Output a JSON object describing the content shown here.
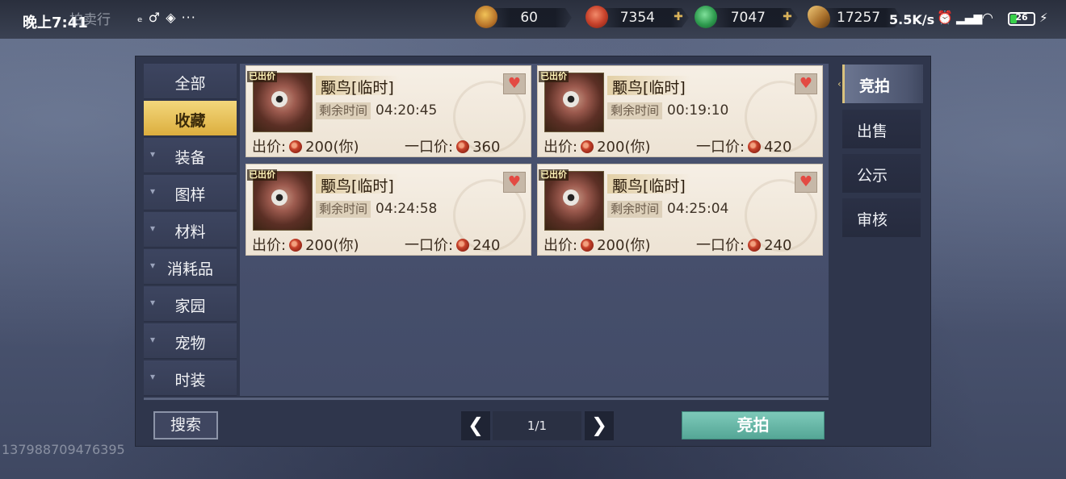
{
  "statusbar": {
    "time": "晚上7:41",
    "app_name": "拍卖行",
    "app_icons": "ₑ ♂ ◈ ···",
    "network_speed": "5.5K/s",
    "battery": "26"
  },
  "resources": [
    {
      "icon": "gold-coin-icon",
      "value": "60",
      "has_plus": false
    },
    {
      "icon": "red-swirl-coin-icon",
      "value": "7354",
      "has_plus": true
    },
    {
      "icon": "green-jade-icon",
      "value": "7047",
      "has_plus": true
    },
    {
      "icon": "feather-token-icon",
      "value": "17257",
      "has_plus": false
    }
  ],
  "categories": [
    {
      "label": "全部",
      "has_arrow": false,
      "active": false
    },
    {
      "label": "收藏",
      "has_arrow": false,
      "active": true
    },
    {
      "label": "装备",
      "has_arrow": true,
      "active": false
    },
    {
      "label": "图样",
      "has_arrow": true,
      "active": false
    },
    {
      "label": "材料",
      "has_arrow": true,
      "active": false
    },
    {
      "label": "消耗品",
      "has_arrow": true,
      "active": false
    },
    {
      "label": "家园",
      "has_arrow": true,
      "active": false
    },
    {
      "label": "宠物",
      "has_arrow": true,
      "active": false
    },
    {
      "label": "时装",
      "has_arrow": true,
      "active": false
    }
  ],
  "right_tabs": [
    {
      "label": "竞拍",
      "active": true
    },
    {
      "label": "出售",
      "active": false
    },
    {
      "label": "公示",
      "active": false
    },
    {
      "label": "审核",
      "active": false
    }
  ],
  "labels": {
    "bid_tag": "已出价",
    "remaining": "剩余时间",
    "bid_prefix": "出价:",
    "buyout_prefix": "一口价:",
    "you_suffix": "(你)"
  },
  "items": [
    {
      "name": "颙鸟[临时]",
      "time_left": "04:20:45",
      "bid": "200",
      "buyout": "360"
    },
    {
      "name": "颙鸟[临时]",
      "time_left": "00:19:10",
      "bid": "200",
      "buyout": "420"
    },
    {
      "name": "颙鸟[临时]",
      "time_left": "04:24:58",
      "bid": "200",
      "buyout": "240"
    },
    {
      "name": "颙鸟[临时]",
      "time_left": "04:25:04",
      "bid": "200",
      "buyout": "240"
    }
  ],
  "bottom": {
    "search_label": "搜索",
    "page": "1/1",
    "auction_label": "竞拍"
  },
  "user_id": "137988709476395"
}
